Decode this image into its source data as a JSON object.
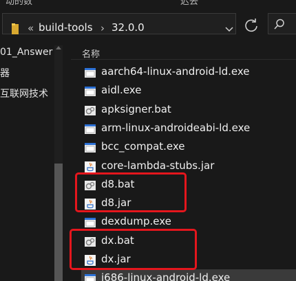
{
  "top_strip": {
    "left_text": "动的数",
    "right_text": "迟去"
  },
  "address_bar": {
    "overflow_chevron": "«",
    "path": [
      "build-tools",
      "32.0.0"
    ],
    "separator": "›"
  },
  "nav_pane": {
    "items": [
      "01_Answer",
      "器",
      "互联网技术"
    ]
  },
  "file_list": {
    "column_name": "名称",
    "files": [
      {
        "name": "aarch64-linux-android-ld.exe",
        "icon": "exe-icon"
      },
      {
        "name": "aidl.exe",
        "icon": "exe-icon"
      },
      {
        "name": "apksigner.bat",
        "icon": "bat-icon"
      },
      {
        "name": "arm-linux-androideabi-ld.exe",
        "icon": "exe-icon"
      },
      {
        "name": "bcc_compat.exe",
        "icon": "exe-icon"
      },
      {
        "name": "core-lambda-stubs.jar",
        "icon": "jar-icon"
      },
      {
        "name": "d8.bat",
        "icon": "bat-icon"
      },
      {
        "name": "d8.jar",
        "icon": "jar-icon"
      },
      {
        "name": "dexdump.exe",
        "icon": "exe-icon"
      },
      {
        "name": "dx.bat",
        "icon": "bat-icon"
      },
      {
        "name": "dx.jar",
        "icon": "jar-icon"
      },
      {
        "name": "i686-linux-android-ld.exe",
        "icon": "exe-icon"
      }
    ]
  },
  "colors": {
    "background": "#191919",
    "highlight": "#e5161d",
    "selected_row": "#3a3a3a"
  }
}
